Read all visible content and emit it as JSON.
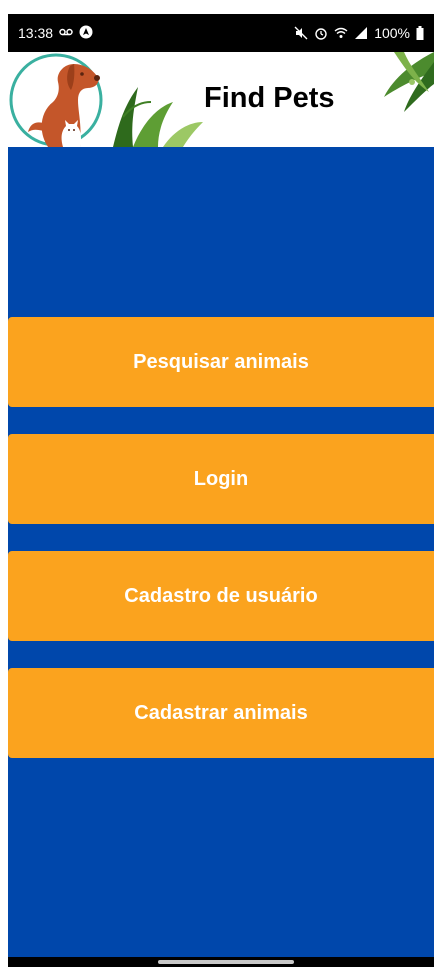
{
  "status_bar": {
    "time": "13:38",
    "battery": "100%",
    "icons_left": [
      "voicemail-icon",
      "navigation-icon"
    ],
    "icons_right": [
      "mute-icon",
      "alarm-icon",
      "wifi-icon",
      "signal-icon",
      "battery-icon"
    ]
  },
  "header": {
    "title": "Find Pets",
    "logo": "dog-cat-logo"
  },
  "menu": {
    "buttons": [
      {
        "label": "Pesquisar animais"
      },
      {
        "label": "Login"
      },
      {
        "label": "Cadastro de usuário"
      },
      {
        "label": "Cadastrar animais"
      }
    ]
  },
  "colors": {
    "background": "#0047AB",
    "button": "#FBA31E",
    "button_text": "#FFFFFF",
    "status_bar": "#000000",
    "logo": "#C4562A",
    "logo_ring": "#3AB0A0"
  }
}
